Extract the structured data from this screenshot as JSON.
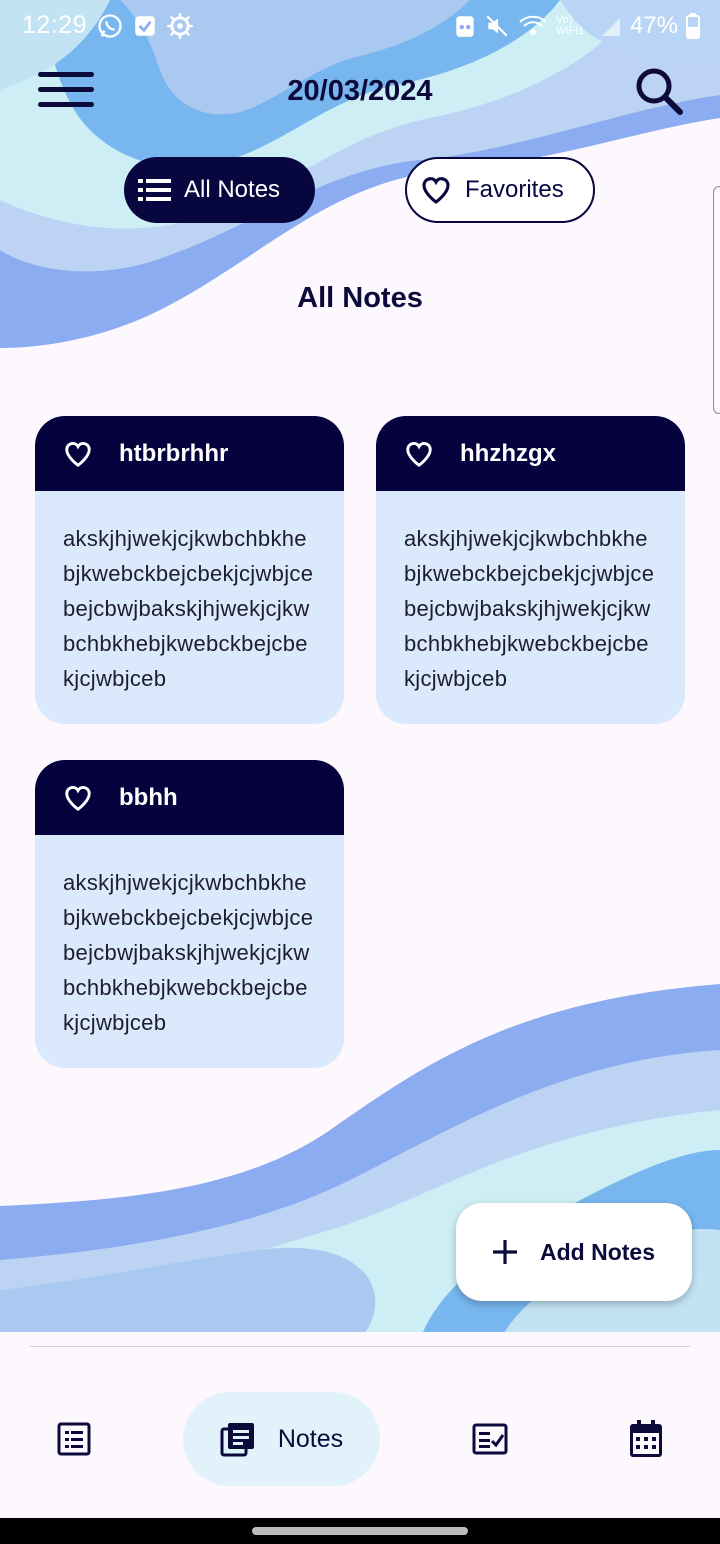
{
  "status_bar": {
    "time": "12:29",
    "battery": "47%",
    "left_icons": [
      "whatsapp-icon",
      "check-badge-icon",
      "settings-icon"
    ],
    "right_icons": [
      "recorder-icon",
      "mute-icon",
      "wifi-calling-icon",
      "signal-icon",
      "battery-icon"
    ],
    "network_label": "Vo) WiFi1"
  },
  "header": {
    "date": "20/03/2024",
    "menu_icon": "menu-icon",
    "search_icon": "search-icon"
  },
  "filters": [
    {
      "label": "All Notes",
      "icon": "list-icon",
      "selected": true
    },
    {
      "label": "Favorites",
      "icon": "heart-icon",
      "selected": false
    }
  ],
  "section_title": "All Notes",
  "notes": [
    {
      "title": "htbrbrhhr",
      "body": "akskjhjwekjcjkwbchbkhebjkwebckbejcbekjcjwbjcebejcbwjbakskjhjwekjcjkwbchbkhebjkwebckbejcbekjcjwbjceb"
    },
    {
      "title": "hhzhzgx",
      "body": "akskjhjwekjcjkwbchbkhebjkwebckbejcbekjcjwbjcebejcbwjbakskjhjwekjcjkwbchbkhebjkwebckbejcbekjcjwbjceb"
    },
    {
      "title": "bbhh",
      "body": "akskjhjwekjcjkwbchbkhebjkwebckbejcbekjcjwbjcebejcbwjbakskjhjwekjcjkwbchbkhebjkwebckbejcbekjcjwbjceb"
    }
  ],
  "fab": {
    "label": "Add Notes",
    "icon": "plus-icon"
  },
  "bottom_nav": [
    {
      "icon": "list-alt-icon",
      "label": ""
    },
    {
      "icon": "notes-icon",
      "label": "Notes",
      "selected": true
    },
    {
      "icon": "task-check-icon",
      "label": ""
    },
    {
      "icon": "calendar-icon",
      "label": ""
    }
  ],
  "colors": {
    "primary": "#06023e",
    "card_body": "#dbe9fd",
    "nav_selected_bg": "#e2f2fb",
    "background": "#fdf8fd"
  }
}
